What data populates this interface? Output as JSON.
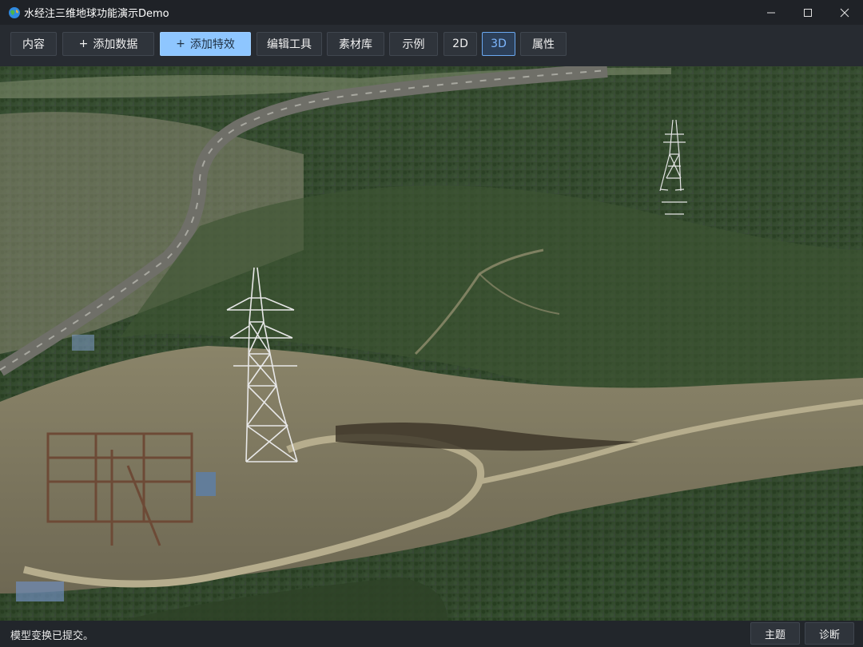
{
  "window": {
    "title": "水经注三维地球功能演示Demo",
    "icon": "globe-icon",
    "controls": [
      "minimize-icon",
      "maximize-icon",
      "close-icon"
    ]
  },
  "toolbar": {
    "content": "内容",
    "add_data": "添加数据",
    "add_effect": "添加特效",
    "edit_tools": "编辑工具",
    "material_library": "素材库",
    "examples": "示例",
    "mode_2d": "2D",
    "mode_3d": "3D",
    "properties": "属性",
    "active_mode": "3D",
    "plus_glyph": "+"
  },
  "statusbar": {
    "message": "模型变换已提交。",
    "theme": "主题",
    "diagnose": "诊断"
  },
  "colors": {
    "primary_button": "#8ec6ff",
    "selected_accent": "#6ba8f0",
    "background": "#1b1e23"
  }
}
